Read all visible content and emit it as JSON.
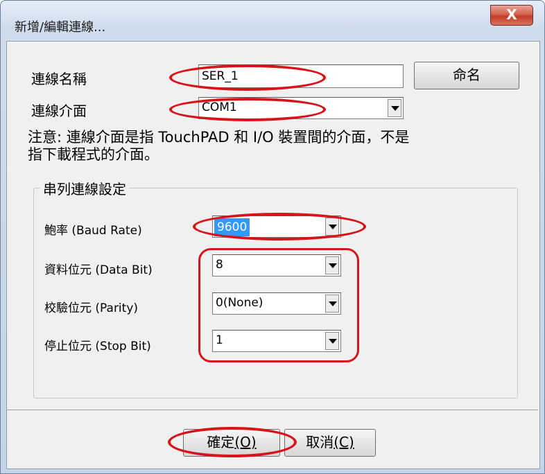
{
  "window": {
    "title": "新增/編輯連線...",
    "close_glyph": "X"
  },
  "connection": {
    "name_label": "連線名稱",
    "name_value": "SER_1",
    "rename_button": "命名",
    "interface_label": "連線介面",
    "interface_value": "COM1",
    "note_line1": "注意: 連線介面是指 TouchPAD 和 I/O 裝置間的介面，不是",
    "note_line2": "指下載程式的介面。"
  },
  "serial": {
    "group_title": "串列連線設定",
    "baud_label": "鮑率 (Baud Rate)",
    "baud_value": "9600",
    "databit_label": "資料位元 (Data Bit)",
    "databit_value": "8",
    "parity_label": "校驗位元 (Parity)",
    "parity_value": "0(None)",
    "stopbit_label": "停止位元 (Stop Bit)",
    "stopbit_value": "1"
  },
  "footer": {
    "ok_text": "確定",
    "ok_key": "(O)",
    "cancel_text": "取消",
    "cancel_key": "(C)"
  },
  "colors": {
    "annotation": "#d7141a",
    "selection": "#3399ff"
  }
}
